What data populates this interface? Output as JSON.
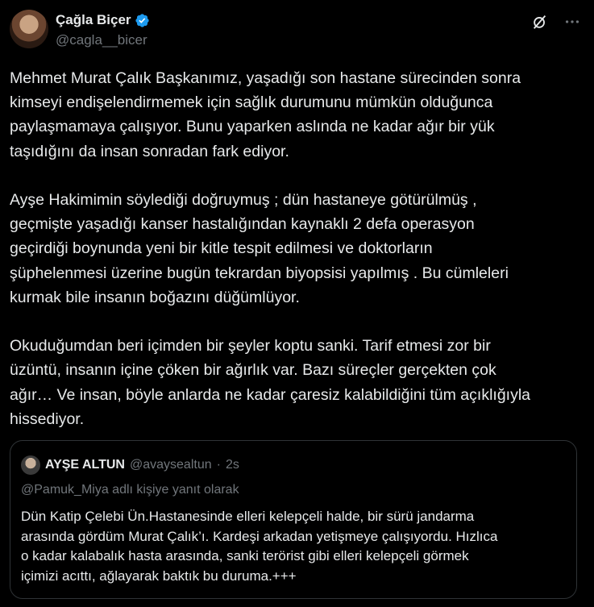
{
  "author": {
    "name": "Çağla Biçer",
    "handle": "@cagla__bicer",
    "verified_color": "#1d9bf0"
  },
  "actions": {
    "grok_icon": "grok-icon",
    "more_icon": "more-options-icon"
  },
  "tweet": {
    "text": "Mehmet Murat Çalık Başkanımız, yaşadığı son hastane sürecinden sonra\nkimseyi endişelendirmemek için sağlık durumunu mümkün olduğunca\npaylaşmamaya çalışıyor. Bunu yaparken aslında ne kadar ağır bir yük\ntaşıdığını da insan sonradan fark ediyor.\n\nAyşe Hakimimin söylediği doğruymuş ; dün hastaneye götürülmüş ,\ngeçmişte yaşadığı kanser hastalığından kaynaklı 2 defa operasyon\ngeçirdiği boynunda yeni bir kitle tespit edilmesi ve doktorların\nşüphelenmesi üzerine bugün tekrardan biyopsisi yapılmış . Bu cümleleri\nkurmak bile insanın boğazını düğümlüyor.\n\nOkuduğumdan beri içimden bir şeyler koptu sanki. Tarif etmesi zor bir\nüzüntü, insanın içine çöken bir ağırlık var. Bazı süreçler gerçekten çok\nağır… Ve insan, böyle anlarda ne kadar çaresiz kalabildiğini tüm açıklığıyla\nhissediyor."
  },
  "quote": {
    "name": "AYŞE ALTUN",
    "handle": "@avaysealtun",
    "dot": "·",
    "time": "2s",
    "reply_to": "@Pamuk_Miya adlı kişiye yanıt olarak",
    "text": "Dün Katip Çelebi Ün.Hastanesinde elleri kelepçeli halde, bir sürü jandarma\narasında gördüm Murat Çalık’ı. Kardeşi arkadan yetişmeye çalışıyordu. Hızlıca\no kadar kalabalık hasta arasında, sanki terörist gibi elleri kelepçeli görmek\niçimizi acıttı, ağlayarak baktık bu duruma.+++"
  }
}
